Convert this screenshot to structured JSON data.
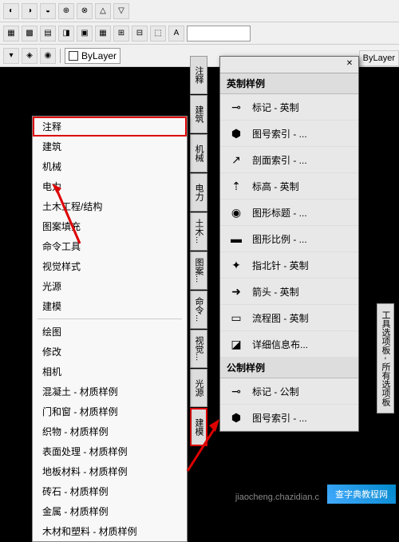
{
  "toolbar": {
    "row1_icons": [
      "◐",
      "◑",
      "◒",
      "⊕",
      "⊗",
      "△",
      "▽"
    ],
    "row2_icons": [
      "▦",
      "▩",
      "▤",
      "◨",
      "▣",
      "▦",
      "⊞",
      "⊟",
      "⬚",
      "A"
    ],
    "row3_layer": "ByLayer",
    "bylayer_right": "ByLayer"
  },
  "context_menu": {
    "groups": [
      [
        "注释",
        "建筑",
        "机械",
        "电力",
        "土木工程/结构",
        "图案填充",
        "命令工具",
        "视觉样式",
        "光源",
        "建模"
      ],
      [
        "绘图",
        "修改",
        "相机",
        "混凝土 - 材质样例",
        "门和窗 - 材质样例",
        "织物 - 材质样例",
        "表面处理 - 材质样例",
        "地板材料 - 材质样例",
        "砖石 - 材质样例",
        "金属 - 材质样例",
        "木材和塑料 - 材质样例"
      ]
    ],
    "highlighted": "注释"
  },
  "side_tabs": [
    "注释",
    "建筑",
    "机械",
    "电力",
    "土木...",
    "图案...",
    "命令...",
    "视觉...",
    "光源",
    "建模"
  ],
  "palette": {
    "section1": "英制样例",
    "items1": [
      {
        "icon": "⊸",
        "label": "标记 - 英制"
      },
      {
        "icon": "⬢",
        "label": "图号索引 - ..."
      },
      {
        "icon": "↗",
        "label": "剖面索引 - ..."
      },
      {
        "icon": "⇡",
        "label": "标高 - 英制"
      },
      {
        "icon": "◉",
        "label": "图形标题 - ..."
      },
      {
        "icon": "▬",
        "label": "图形比例 - ..."
      },
      {
        "icon": "✦",
        "label": "指北针 - 英制"
      },
      {
        "icon": "➜",
        "label": "箭头 - 英制"
      },
      {
        "icon": "▭",
        "label": "流程图 - 英制"
      },
      {
        "icon": "◪",
        "label": "详细信息布..."
      }
    ],
    "section2": "公制样例",
    "items2": [
      {
        "icon": "⊸",
        "label": "标记 - 公制"
      },
      {
        "icon": "⬢",
        "label": "图号索引 - ..."
      }
    ]
  },
  "vertical_label": "工具选项板 - 所有选项板",
  "watermark": "查字典教程网",
  "watermark_url": "jiaocheng.chazidian.c"
}
